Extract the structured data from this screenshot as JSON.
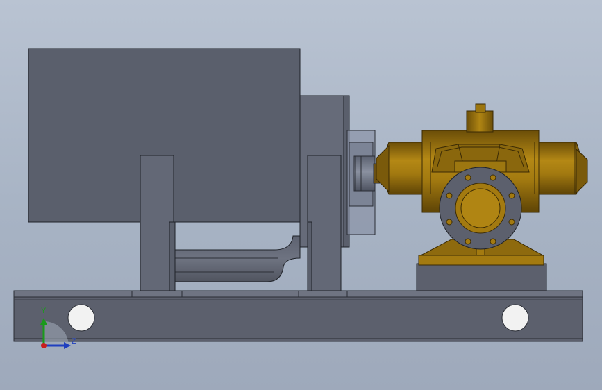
{
  "viewport": {
    "background_top": "#b9c3d2",
    "background_bottom": "#9ea9bb"
  },
  "model": {
    "parts": [
      {
        "name": "electric-motor",
        "color": "#5a5f6c"
      },
      {
        "name": "coupling",
        "color": "#7c8496"
      },
      {
        "name": "split-case-pump",
        "color": "#a97f13"
      },
      {
        "name": "base-frame",
        "color": "#5c606d"
      }
    ]
  },
  "triad": {
    "y_label": "Y",
    "z_label": "Z",
    "y_color": "#1a9a1a",
    "z_color": "#1f3fbf",
    "x_color": "#c81e1e"
  }
}
